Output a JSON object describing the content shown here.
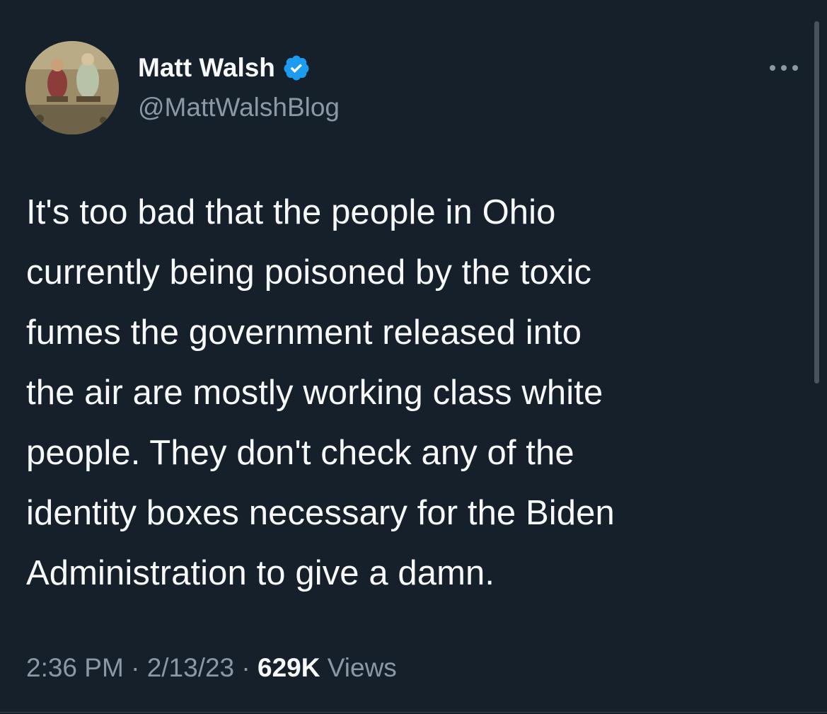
{
  "author": {
    "display_name": "Matt Walsh",
    "handle": "@MattWalshBlog",
    "verified": true,
    "avatar_icon": "profile-avatar"
  },
  "tweet": {
    "text": "It's too bad that the people in Ohio\ncurrently being poisoned by the toxic\nfumes the government released into\nthe air are mostly working class white\npeople. They don't check any of the\nidentity boxes necessary for the Biden\nAdministration to give a damn.",
    "time": "2:36 PM",
    "separator": "·",
    "date": "2/13/23",
    "views_count": "629K",
    "views_label": "Views"
  },
  "colors": {
    "background": "#15202b",
    "text_primary": "#f7f9f9",
    "text_secondary": "#8b98a5",
    "verified_badge": "#1d9bf0"
  },
  "icons": {
    "more": "more-horizontal-icon",
    "verified": "verified-badge-icon"
  }
}
